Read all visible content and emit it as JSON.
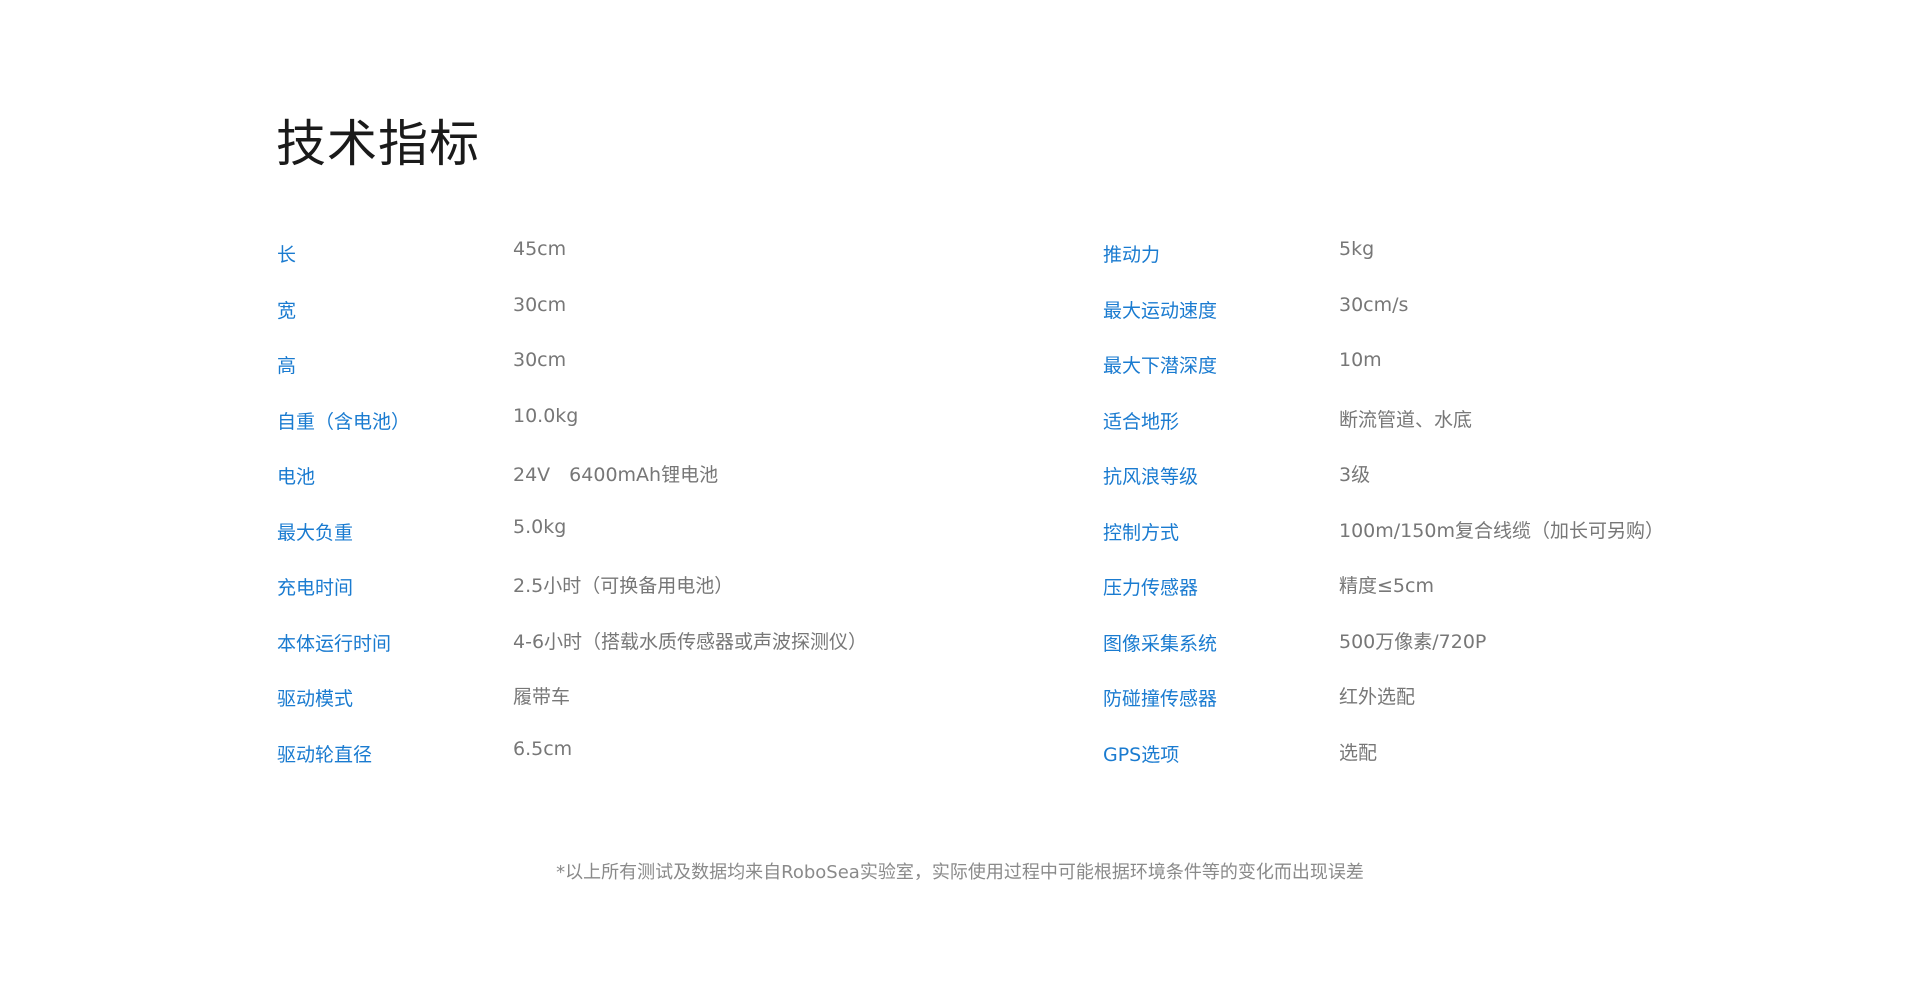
{
  "title": "技术指标",
  "left_specs": [
    {
      "label": "长",
      "value": "45cm"
    },
    {
      "label": "宽",
      "value": "30cm"
    },
    {
      "label": "高",
      "value": "30cm"
    },
    {
      "label": "自重（含电池）",
      "value": "10.0kg"
    },
    {
      "label": "电池",
      "value": "24V　6400mAh锂电池"
    },
    {
      "label": "最大负重",
      "value": "5.0kg"
    },
    {
      "label": "充电时间",
      "value": "2.5小时（可换备用电池）"
    },
    {
      "label": "本体运行时间",
      "value": "4-6小时（搭载水质传感器或声波探测仪）"
    },
    {
      "label": "驱动模式",
      "value": "履带车"
    },
    {
      "label": "驱动轮直径",
      "value": "6.5cm"
    }
  ],
  "right_specs": [
    {
      "label": "推动力",
      "value": "5kg"
    },
    {
      "label": "最大运动速度",
      "value": "30cm/s"
    },
    {
      "label": "最大下潜深度",
      "value": "10m"
    },
    {
      "label": "适合地形",
      "value": "断流管道、水底"
    },
    {
      "label": "抗风浪等级",
      "value": "3级"
    },
    {
      "label": "控制方式",
      "value": "100m/150m复合线缆（加长可另购）"
    },
    {
      "label": "压力传感器",
      "value": "精度≤5cm"
    },
    {
      "label": "图像采集系统",
      "value": "500万像素/720P"
    },
    {
      "label": "防碰撞传感器",
      "value": "红外选配"
    },
    {
      "label": "GPS选项",
      "value": "选配"
    }
  ],
  "footnote": "*以上所有测试及数据均来自RoboSea实验室，实际使用过程中可能根据环境条件等的变化而出现误差",
  "colors": {
    "label": "#1a7bd0",
    "value": "#777777",
    "title": "#1a1a1a",
    "footnote": "#8a8a8a"
  }
}
